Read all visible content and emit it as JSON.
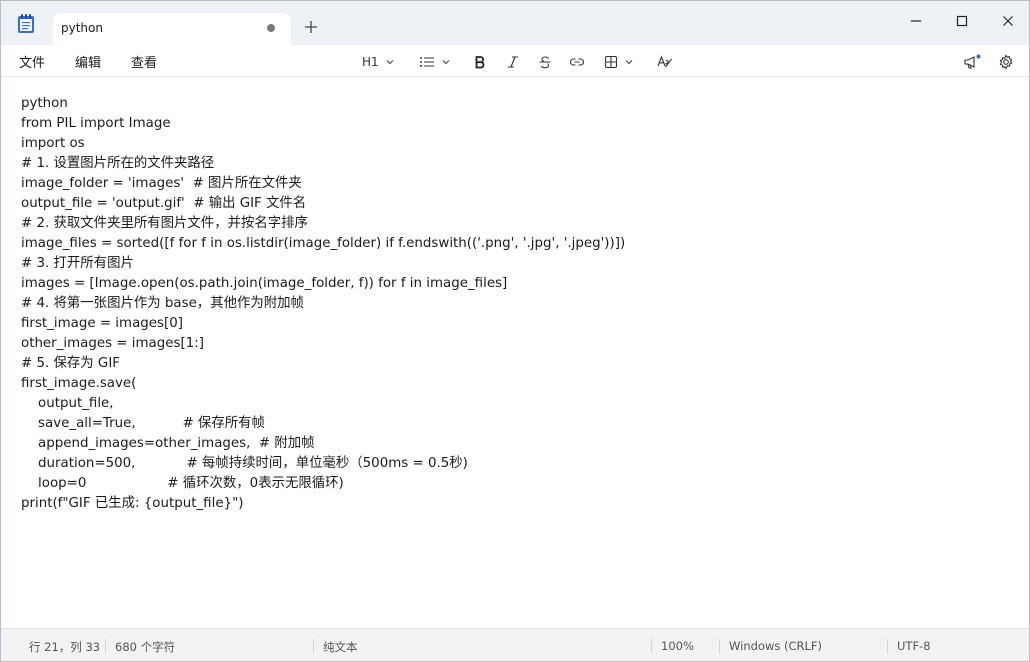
{
  "app": {
    "tab_title": "python",
    "accent": "#2f6fd6"
  },
  "menus": [
    "文件",
    "编辑",
    "查看"
  ],
  "toolbar": {
    "heading_label": "H1",
    "icons": [
      "list-icon",
      "bold-icon",
      "italic-icon",
      "strikethrough-icon",
      "link-icon",
      "table-icon",
      "clear-formatting-icon"
    ]
  },
  "editor": {
    "lines": [
      "python",
      "from PIL import Image",
      "import os",
      "# 1. 设置图片所在的文件夹路径",
      "image_folder = 'images'  # 图片所在文件夹",
      "output_file = 'output.gif'  # 输出 GIF 文件名",
      "# 2. 获取文件夹里所有图片文件，并按名字排序",
      "image_files = sorted([f for f in os.listdir(image_folder) if f.endswith(('.png', '.jpg', '.jpeg'))])",
      "# 3. 打开所有图片",
      "images = [Image.open(os.path.join(image_folder, f)) for f in image_files]",
      "# 4. 将第一张图片作为 base，其他作为附加帧",
      "first_image = images[0]",
      "other_images = images[1:]",
      "# 5. 保存为 GIF",
      "first_image.save(",
      "    output_file,",
      "    save_all=True,           # 保存所有帧",
      "    append_images=other_images,  # 附加帧",
      "    duration=500,            # 每帧持续时间，单位毫秒（500ms = 0.5秒)",
      "    loop=0                   # 循环次数，0表示无限循环)",
      "print(f\"GIF 已生成: {output_file}\")"
    ]
  },
  "status": {
    "position": "行 21，列 33",
    "chars": "680 个字符",
    "format": "纯文本",
    "zoom": "100%",
    "line_ending": "Windows (CRLF)",
    "encoding": "UTF-8"
  }
}
